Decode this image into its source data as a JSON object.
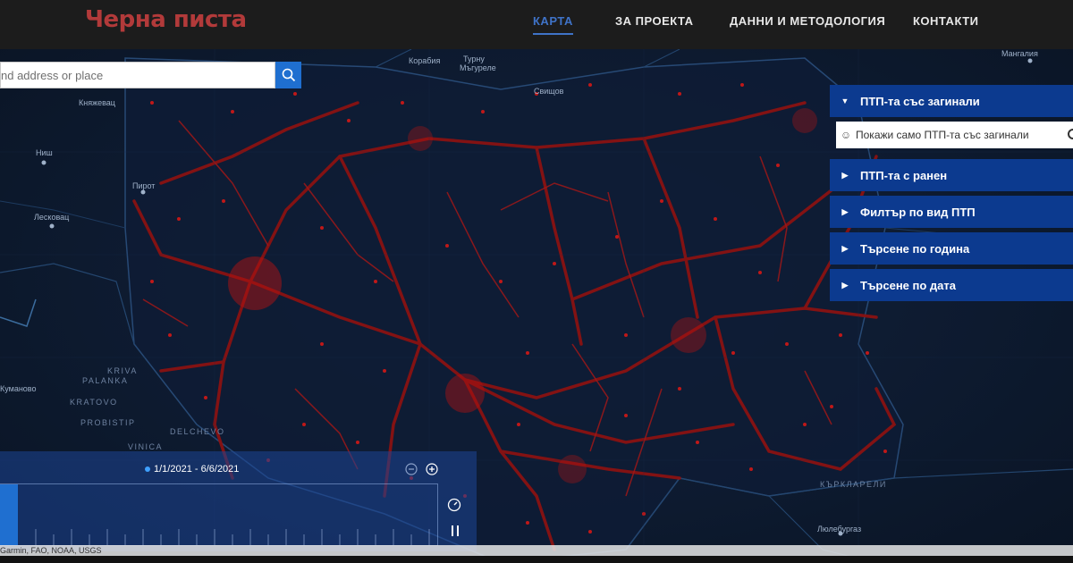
{
  "header": {
    "logo": "Черна писта",
    "nav": [
      {
        "label": "КАРТА",
        "active": true
      },
      {
        "label": "ЗА ПРОЕКТА",
        "active": false
      },
      {
        "label": "ДАННИ И МЕТОДОЛОГИЯ",
        "active": false
      },
      {
        "label": "КОНТАКТИ",
        "active": false
      }
    ]
  },
  "search": {
    "placeholder": "nd address or place"
  },
  "map_labels": {
    "korabiya": "Корабия",
    "turnu": "Турну",
    "magurele": "Мъгуреле",
    "svishtov": "Свищов",
    "knyazhevats": "Княжевац",
    "nish": "Ниш",
    "pirot": "Пирот",
    "leskovats": "Лесковац",
    "mangalia": "Мангалия",
    "kumanovo": "Куманово",
    "kriva": "KRIVA",
    "palanka": "PALANKA",
    "kratovo": "KRATOVO",
    "probistip": "PROBISTIP",
    "delchevo": "DELCHEVO",
    "vinica": "VINICA",
    "kirklareli": "КЪРКЛАРЕЛИ",
    "lyuleburgaz": "Люлебургаз"
  },
  "panel": {
    "sections": [
      {
        "label": "ПТП-та със загинали",
        "expanded": true
      },
      {
        "label": "ПТП-та с ранен",
        "expanded": false
      },
      {
        "label": "Филтър по вид ПТП",
        "expanded": false
      },
      {
        "label": "Търсене по година",
        "expanded": false
      },
      {
        "label": "Търсене по дата",
        "expanded": false
      }
    ],
    "toggle_label": "Покажи само ПТП-та със загинали"
  },
  "timeline": {
    "date_range": "1/1/2021 - 6/6/2021"
  },
  "attribution": "Garmin, FAO, NOAA, USGS",
  "colors": {
    "header_bg": "#1c1c1c",
    "logo": "#b23a3a",
    "nav_active": "#3f73c8",
    "panel_header": "#0c3a8f",
    "accident_dot": "#b01414",
    "search_button": "#1f6fd0"
  },
  "icons": {
    "search": "search-icon",
    "expand": "caret-right-icon",
    "collapse": "caret-down-icon",
    "zoom_in": "plus-circle-icon",
    "zoom_out": "minus-circle-icon",
    "speed": "gauge-icon",
    "pause": "pause-icon",
    "face": "face-icon"
  }
}
